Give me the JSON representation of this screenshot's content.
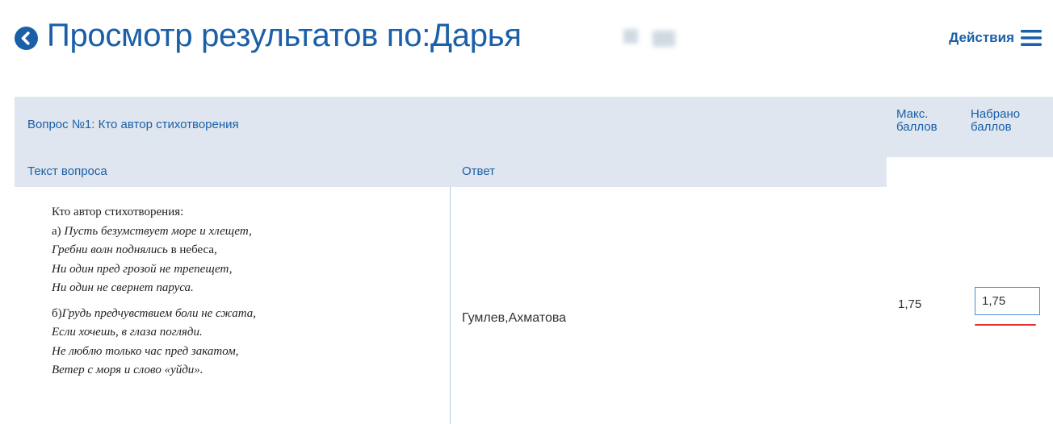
{
  "header": {
    "title": "Просмотр результатов по:Дарья",
    "actions_label": "Действия"
  },
  "question": {
    "title": "Вопрос №1: Кто автор стихотворения",
    "col_question": "Текст вопроса",
    "col_answer": "Ответ",
    "max_points_label": "Макс. баллов",
    "earned_points_label": "Набрано баллов",
    "text": {
      "intro": "Кто автор стихотворения:",
      "a_prefix": "а) ",
      "a_line1": "Пусть безумствует море и хлещет,",
      "a_line2_italic": "Гребни волн поднялись",
      "a_line2_rest": " в небеса,",
      "a_line3": "Ни один пред грозой не трепещет,",
      "a_line4": "Ни один не свернет паруса.",
      "b_prefix": "б)",
      "b_line1": "Грудь предчувствием боли не сжата,",
      "b_line2": "Если хочешь, в глаза погляди.",
      "b_line3": "Не люблю только час пред закатом,",
      "b_line4": "Ветер с моря и слово «уйди»."
    },
    "answer": "Гумлев,Ахматова",
    "max_points": "1,75",
    "earned_points": "1,75"
  },
  "colors": {
    "accent": "#1a5fa8",
    "header_bg": "#dfe6ef",
    "input_border": "#4a90d9",
    "spellcheck": "#e0312f"
  },
  "icons": {
    "back": "circle-chevron-left-icon",
    "menu": "hamburger-menu-icon"
  }
}
